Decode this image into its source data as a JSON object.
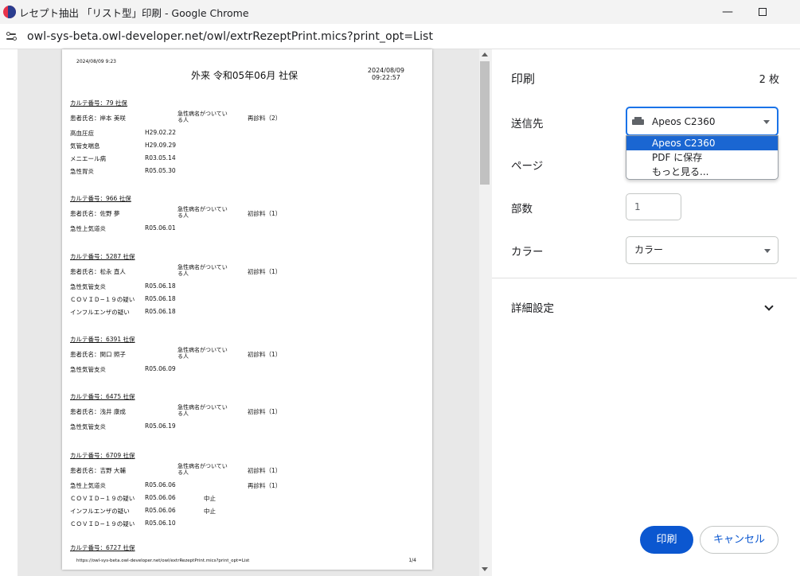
{
  "window": {
    "title": "レセプト抽出 「リスト型」印刷 - Google Chrome",
    "minimize_glyph": "—"
  },
  "address": {
    "url": "owl-sys-beta.owl-developer.net/owl/extrRezeptPrint.mics?print_opt=List"
  },
  "document": {
    "print_stamp": "2024/08/09 9:23",
    "title": "外来 令和05年06月 社保",
    "date": "2024/08/09",
    "time": "09:22:57",
    "footer_url": "https://owl-sys-beta.owl-developer.net/owl/extrRezeptPrint.mics?print_opt=List",
    "page_num": "1/4",
    "records": [
      {
        "card": "カルテ番号：79 社保",
        "name": "患者氏名：岸本 美咲",
        "note": [
          "急性病名がついてい",
          "る人"
        ],
        "visit": "再診料（2）",
        "rows": [
          [
            "高血圧症",
            "H29.02.22",
            "",
            ""
          ],
          [
            "気管支喘息",
            "H29.09.29",
            "",
            ""
          ],
          [
            "メニエール病",
            "R03.05.14",
            "",
            ""
          ],
          [
            "急性胃炎",
            "R05.05.30",
            "",
            ""
          ]
        ]
      },
      {
        "card": "カルテ番号：966 社保",
        "name": "患者氏名：佐野 夢",
        "note": [
          "急性病名がついてい",
          "る人"
        ],
        "visit": "初診料（1）",
        "rows": [
          [
            "急性上気道炎",
            "R05.06.01",
            "",
            ""
          ]
        ]
      },
      {
        "card": "カルテ番号：5287 社保",
        "name": "患者氏名：松永 直人",
        "note": [
          "急性病名がついてい",
          "る人"
        ],
        "visit": "初診料（1）",
        "rows": [
          [
            "急性気管支炎",
            "R05.06.18",
            "",
            ""
          ],
          [
            "ＣＯＶＩＤ−１９の疑い",
            "R05.06.18",
            "",
            ""
          ],
          [
            "インフルエンザの疑い",
            "R05.06.18",
            "",
            ""
          ]
        ]
      },
      {
        "card": "カルテ番号：6391 社保",
        "name": "患者氏名：関口 照子",
        "note": [
          "急性病名がついてい",
          "る人"
        ],
        "visit": "初診料（1）",
        "rows": [
          [
            "急性気管支炎",
            "R05.06.09",
            "",
            ""
          ]
        ]
      },
      {
        "card": "カルテ番号：6475 社保",
        "name": "患者氏名：浅井 康成",
        "note": [
          "急性病名がついてい",
          "る人"
        ],
        "visit": "初診料（1）",
        "rows": [
          [
            "急性気管支炎",
            "R05.06.19",
            "",
            ""
          ]
        ]
      },
      {
        "card": "カルテ番号：6709 社保",
        "name": "患者氏名：吉野 大輔",
        "note": [
          "急性病名がついてい",
          "る人"
        ],
        "visit": "初診料（1）",
        "rows": [
          [
            "急性上気道炎",
            "R05.06.06",
            "",
            "再診料（1）"
          ],
          [
            "ＣＯＶＩＤ−１９の疑い",
            "R05.06.06",
            "中止",
            ""
          ],
          [
            "インフルエンザの疑い",
            "R05.06.06",
            "中止",
            ""
          ],
          [
            "ＣＯＶＩＤ−１９の疑い",
            "R05.06.10",
            "",
            ""
          ]
        ]
      },
      {
        "card": "カルテ番号：6727 社保",
        "name": "",
        "note": [
          "",
          ""
        ],
        "visit": "",
        "rows": []
      }
    ]
  },
  "print_panel": {
    "title": "印刷",
    "sheets": "2 枚",
    "destination_label": "送信先",
    "destination_value": "Apeos C2360",
    "destination_options": [
      "Apeos C2360",
      "PDF に保存",
      "もっと見る..."
    ],
    "pages_label": "ページ",
    "copies_label": "部数",
    "copies_value": "1",
    "color_label": "カラー",
    "color_value": "カラー",
    "advanced_label": "詳細設定",
    "print_button": "印刷",
    "cancel_button": "キャンセル"
  }
}
